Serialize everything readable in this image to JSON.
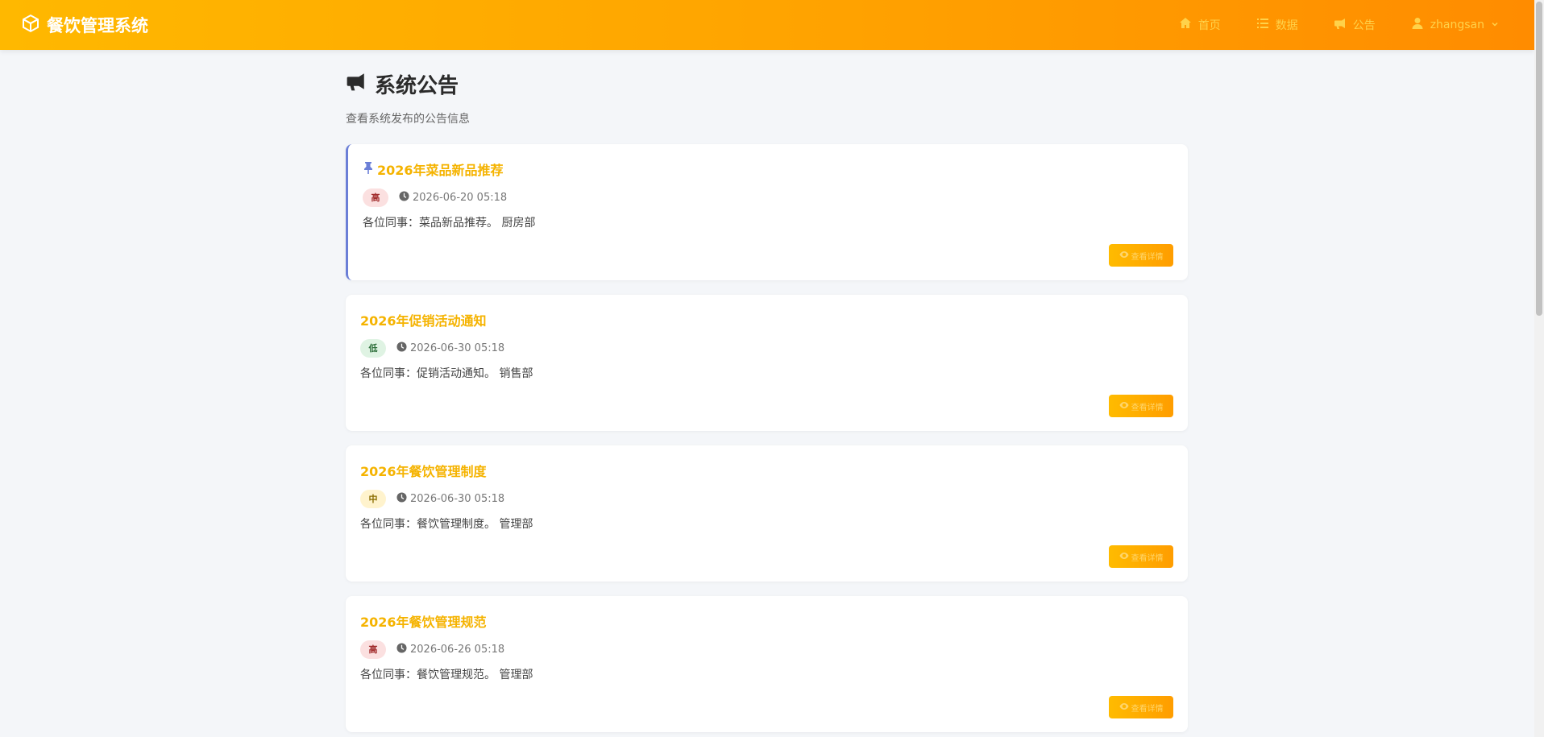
{
  "app": {
    "title": "餐饮管理系统"
  },
  "nav": {
    "items": [
      {
        "label": "首页",
        "icon": "home-icon"
      },
      {
        "label": "数据",
        "icon": "list-icon"
      },
      {
        "label": "公告",
        "icon": "megaphone-icon"
      }
    ],
    "user": {
      "label": "zhangsan",
      "icon": "user-icon"
    }
  },
  "page": {
    "title": "系统公告",
    "subtitle": "查看系统发布的公告信息"
  },
  "announcements": [
    {
      "title": "2026年菜品新品推荐",
      "pinned": true,
      "priority": "高",
      "priority_level": "high",
      "time": "2026-06-20 05:18",
      "content": "各位同事：菜品新品推荐。 厨房部",
      "button": "查看详情"
    },
    {
      "title": "2026年促销活动通知",
      "pinned": false,
      "priority": "低",
      "priority_level": "low",
      "time": "2026-06-30 05:18",
      "content": "各位同事：促销活动通知。 销售部",
      "button": "查看详情"
    },
    {
      "title": "2026年餐饮管理制度",
      "pinned": false,
      "priority": "中",
      "priority_level": "mid",
      "time": "2026-06-30 05:18",
      "content": "各位同事：餐饮管理制度。 管理部",
      "button": "查看详情"
    },
    {
      "title": "2026年餐饮管理规范",
      "pinned": false,
      "priority": "高",
      "priority_level": "high",
      "time": "2026-06-26 05:18",
      "content": "各位同事：餐饮管理规范。 管理部",
      "button": "查看详情"
    }
  ],
  "colors": {
    "accent": "#ffa200",
    "title_text": "#f5b300",
    "pin_border": "#6b7fd7",
    "background": "#f4f6f9"
  }
}
